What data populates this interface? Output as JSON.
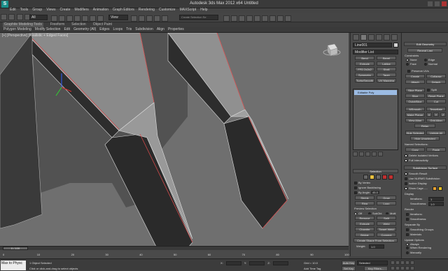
{
  "title_bar": {
    "logo": "S",
    "title": "Autodesk 3ds Max 2012 x64    Untitled"
  },
  "menu": [
    "Edit",
    "Tools",
    "Group",
    "Views",
    "Create",
    "Modifiers",
    "Animation",
    "Graph Editors",
    "Rendering",
    "Customize",
    "MAXScript",
    "Help"
  ],
  "toolbar": {
    "selection_filter": "All",
    "view_dropdown": "View",
    "selection_set": "Create Selection Se"
  },
  "ribbon_tabs": [
    "Graphite Modeling Tools",
    "Freeform",
    "Selection",
    "Object Paint"
  ],
  "ribbon_sub": [
    "Polygon Modeling",
    "Modify Selection",
    "Edit",
    "Geometry (All)",
    "Edges",
    "Loops",
    "Tris",
    "Subdivision",
    "Align",
    "Properties"
  ],
  "viewport": {
    "label": "[+] [Perspective] [Realistic + Edged Faces]"
  },
  "command_panel": {
    "object_name": "Line001",
    "modifier_list": "Modifier List",
    "modifier_buttons": [
      "Bend",
      "Bevel",
      "Extrude",
      "Lattice",
      "FFD 2x2x2",
      "Shell",
      "Symmetry",
      "Taper",
      "TurboSmooth",
      "UV Mapping Ctr"
    ],
    "stack_item": "Editable Poly",
    "selection": {
      "header": "Selection",
      "by_vertex": "By Vertex",
      "ignore_backfacing": "Ignore Backfacing",
      "by_angle": "By Angle:",
      "by_angle_value": "45.0",
      "shrink": "Shrink",
      "grow": "Grow",
      "ring": "Ring",
      "loop": "Loop",
      "preview_selection": "Preview Selection",
      "preview_off": "Off",
      "preview_subobj": "SubObj",
      "preview_multi": "Multi",
      "status": "196 Edges Selected"
    },
    "soft_selection": "Soft Selection",
    "edit_edges": {
      "header": "Edit Edges",
      "insert_vertex": "Insert Vertex",
      "remove": "Remove",
      "split": "Split",
      "extrude": "Extrude",
      "weld": "Weld",
      "chamfer": "Chamfer",
      "target_weld": "Target Weld",
      "bridge": "Bridge",
      "connect": "Connect",
      "create_shape": "Create Shape From Selection",
      "weight_label": "Weight:",
      "weight_value": "1.0"
    }
  },
  "right_panel": {
    "edit_geometry": "Edit Geometry",
    "repeat_last": "Repeat Last",
    "constraints": "Constraints",
    "none": "None",
    "edge": "Edge",
    "face": "Face",
    "normal": "Normal",
    "preserve_uvs": "Preserve UVs",
    "create": "Create",
    "collapse": "Collapse",
    "attach": "Attach",
    "detach": "Detach",
    "slice_plane": "Slice Plane",
    "split": "Split",
    "slice": "Slice",
    "reset_plane": "Reset Plane",
    "quickslice": "QuickSlice",
    "cut": "Cut",
    "meshsmooth": "MSmooth",
    "tessellate": "Tessellate",
    "make_planar": "Make Planar",
    "x": "X",
    "y": "Y",
    "z": "Z",
    "view_align": "View Align",
    "grid_align": "Grid Align",
    "relax": "Relax",
    "hide_selected": "Hide Selected",
    "unhide_all": "Unhide All",
    "hide_unselected": "Hide Unselected",
    "named_selections": "Named Selections:",
    "copy": "Copy",
    "paste": "Paste",
    "delete_isolated": "Delete Isolated Vertices",
    "full_interactivity": "Full Interactivity",
    "subdivision_surface": "Subdivision Surface",
    "smooth_result": "Smooth Result",
    "use_nurms": "Use NURMS Subdivision",
    "isoline_display": "Isoline Display",
    "show_cage": "Show Cage......",
    "display": "Display",
    "iterations": "Iterations:",
    "iterations_value": "1",
    "smoothness": "Smoothness:",
    "smoothness_value": "1.0",
    "render": "Render",
    "separate_by": "Separate By",
    "smoothing_groups": "Smoothing Groups",
    "materials": "Materials",
    "update_options": "Update Options",
    "always": "Always",
    "when_rendering": "When Rendering",
    "manually": "Manually"
  },
  "timeline": {
    "frame": "0 / 100",
    "ticks": [
      "0",
      "10",
      "20",
      "30",
      "40",
      "50",
      "60",
      "70",
      "80",
      "90",
      "100"
    ]
  },
  "status": {
    "maxscript": "Max to Physc",
    "objects_selected": "1 Object Selected",
    "prompt": "Click or click-and-drag to select objects",
    "x_label": "X:",
    "y_label": "Y:",
    "z_label": "Z:",
    "grid": "Grid = 10.0",
    "auto_key": "Auto Key",
    "selected": "Selected",
    "set_key": "Set Key",
    "key_filters": "Key Filters...",
    "add_time_tag": "Add Time Tag"
  }
}
